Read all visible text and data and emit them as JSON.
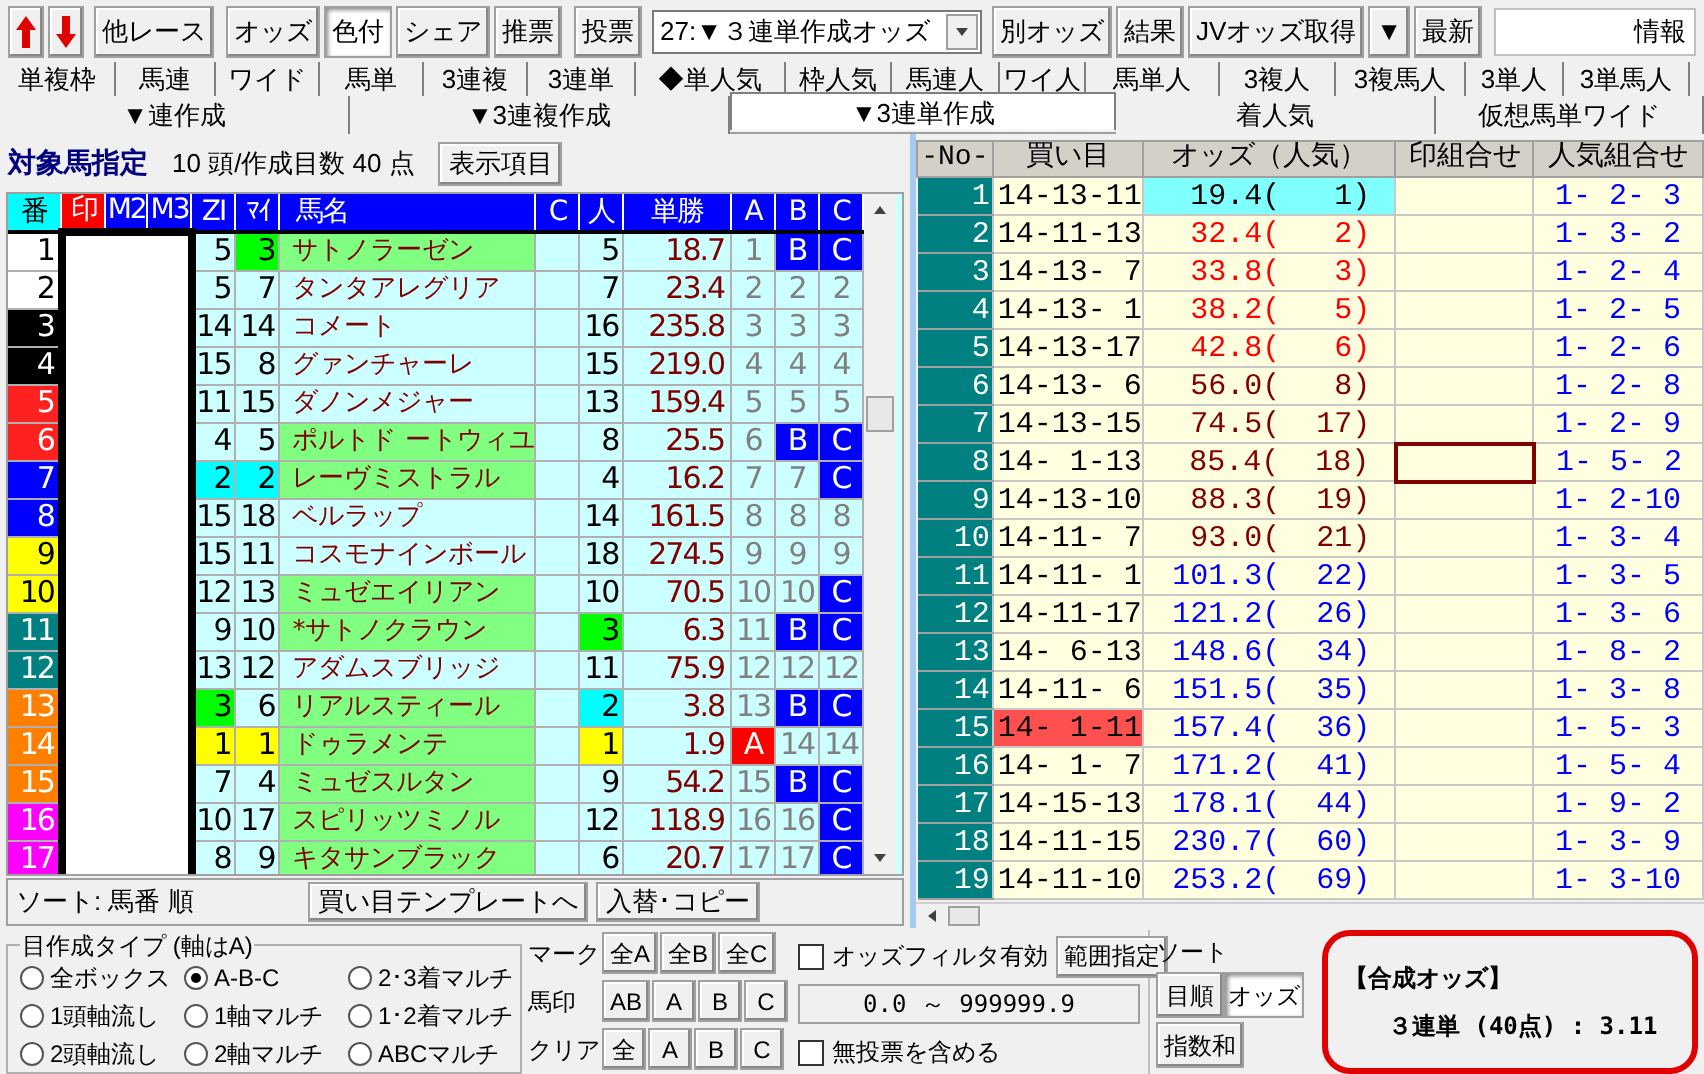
{
  "toolbar": {
    "buttons": [
      {
        "label": "他レース",
        "pressed": false
      },
      {
        "label": "オッズ",
        "pressed": false
      },
      {
        "label": "色付",
        "pressed": true
      },
      {
        "label": "シェア",
        "pressed": false
      },
      {
        "label": "推票",
        "pressed": false
      },
      {
        "label": "投票",
        "pressed": false
      }
    ],
    "dropdown": {
      "value": "27:▼３連単作成オッズ"
    },
    "right_buttons": [
      {
        "label": "別オッズ",
        "pressed": false
      },
      {
        "label": "結果",
        "pressed": false
      },
      {
        "label": "JVオッズ取得",
        "pressed": false
      },
      {
        "label": "▼",
        "pressed": false
      },
      {
        "label": "最新",
        "pressed": false
      }
    ],
    "info": "情報"
  },
  "bet_type_tabs": [
    "単複枠",
    "馬連",
    "ワイド",
    "馬単",
    "3連複",
    "3連単",
    "◆単人気",
    "枠人気",
    "馬連人",
    "ワイ人",
    "馬単人",
    "3複人",
    "3複馬人",
    "3単人",
    "3単馬人"
  ],
  "create_tabs": [
    {
      "label": "▼連作成",
      "selected": false
    },
    {
      "label": "▼3連複作成",
      "selected": false
    },
    {
      "label": "▼3連単作成",
      "selected": true
    },
    {
      "label": "着人気",
      "selected": false
    },
    {
      "label": "仮想馬単ワイド",
      "selected": false
    }
  ],
  "target": {
    "title": "対象馬指定",
    "summary": "10 頭/作成目数 40 点",
    "button": "表示項目"
  },
  "horse_table": {
    "columns": [
      "番",
      "印",
      "M2",
      "M3",
      "ZI",
      "ﾏｲ",
      "馬名",
      "C",
      "人",
      "単勝",
      "A",
      "B",
      "C"
    ],
    "rows": [
      {
        "no": "1",
        "color": "#ffffff",
        "zi": {
          "text": "5"
        },
        "mai": {
          "text": "3",
          "color": "#00ff00"
        },
        "name": "サトノラーゼン",
        "highlighted": true,
        "ninki": {
          "text": "5"
        },
        "win": "18.7",
        "a": {
          "text": "1",
          "marked": false
        },
        "b": {
          "text": "B",
          "marked": true
        },
        "c": {
          "text": "C",
          "marked": true
        }
      },
      {
        "no": "2",
        "color": "#ffffff",
        "zi": {
          "text": "5"
        },
        "mai": {
          "text": "7"
        },
        "name": "タンタアレグリア",
        "highlighted": false,
        "ninki": {
          "text": "7"
        },
        "win": "23.4",
        "a": {
          "text": "2",
          "marked": false
        },
        "b": {
          "text": "2",
          "marked": false
        },
        "c": {
          "text": "2",
          "marked": false
        }
      },
      {
        "no": "3",
        "color": "#000000",
        "zi": {
          "text": "14"
        },
        "mai": {
          "text": "14"
        },
        "name": "コメート",
        "highlighted": false,
        "ninki": {
          "text": "16"
        },
        "win": "235.8",
        "a": {
          "text": "3",
          "marked": false
        },
        "b": {
          "text": "3",
          "marked": false
        },
        "c": {
          "text": "3",
          "marked": false
        }
      },
      {
        "no": "4",
        "color": "#000000",
        "zi": {
          "text": "15"
        },
        "mai": {
          "text": "8"
        },
        "name": "グァンチャーレ",
        "highlighted": false,
        "ninki": {
          "text": "15"
        },
        "win": "219.0",
        "a": {
          "text": "4",
          "marked": false
        },
        "b": {
          "text": "4",
          "marked": false
        },
        "c": {
          "text": "4",
          "marked": false
        }
      },
      {
        "no": "5",
        "color": "#ff2020",
        "zi": {
          "text": "11"
        },
        "mai": {
          "text": "15"
        },
        "name": "ダノンメジャー",
        "highlighted": false,
        "ninki": {
          "text": "13"
        },
        "win": "159.4",
        "a": {
          "text": "5",
          "marked": false
        },
        "b": {
          "text": "5",
          "marked": false
        },
        "c": {
          "text": "5",
          "marked": false
        }
      },
      {
        "no": "6",
        "color": "#ff2020",
        "zi": {
          "text": "4"
        },
        "mai": {
          "text": "5"
        },
        "name": "ポルトド ートウィユ",
        "highlighted": true,
        "ninki": {
          "text": "8"
        },
        "win": "25.5",
        "a": {
          "text": "6",
          "marked": false
        },
        "b": {
          "text": "B",
          "marked": true
        },
        "c": {
          "text": "C",
          "marked": true
        }
      },
      {
        "no": "7",
        "color": "#0000ff",
        "zi": {
          "text": "2",
          "color": "#00ffff"
        },
        "mai": {
          "text": "2",
          "color": "#00ffff"
        },
        "name": "レーヴミストラル",
        "highlighted": true,
        "ninki": {
          "text": "4"
        },
        "win": "16.2",
        "a": {
          "text": "7",
          "marked": false
        },
        "b": {
          "text": "7",
          "marked": false
        },
        "c": {
          "text": "C",
          "marked": true
        }
      },
      {
        "no": "8",
        "color": "#0000ff",
        "zi": {
          "text": "15"
        },
        "mai": {
          "text": "18"
        },
        "name": "ベルラップ",
        "highlighted": false,
        "ninki": {
          "text": "14"
        },
        "win": "161.5",
        "a": {
          "text": "8",
          "marked": false
        },
        "b": {
          "text": "8",
          "marked": false
        },
        "c": {
          "text": "8",
          "marked": false
        }
      },
      {
        "no": "9",
        "color": "#ffff00",
        "zi": {
          "text": "15"
        },
        "mai": {
          "text": "11"
        },
        "name": "コスモナインボール",
        "highlighted": false,
        "ninki": {
          "text": "18"
        },
        "win": "274.5",
        "a": {
          "text": "9",
          "marked": false
        },
        "b": {
          "text": "9",
          "marked": false
        },
        "c": {
          "text": "9",
          "marked": false
        }
      },
      {
        "no": "10",
        "color": "#ffff00",
        "zi": {
          "text": "12"
        },
        "mai": {
          "text": "13"
        },
        "name": "ミュゼエイリアン",
        "highlighted": true,
        "ninki": {
          "text": "10"
        },
        "win": "70.5",
        "a": {
          "text": "10",
          "marked": false
        },
        "b": {
          "text": "10",
          "marked": false
        },
        "c": {
          "text": "C",
          "marked": true
        }
      },
      {
        "no": "11",
        "color": "#008080",
        "zi": {
          "text": "9"
        },
        "mai": {
          "text": "10"
        },
        "name": "*サトノクラウン",
        "highlighted": true,
        "ninki": {
          "text": "3",
          "color": "#00ff00"
        },
        "win": "6.3",
        "a": {
          "text": "11",
          "marked": false
        },
        "b": {
          "text": "B",
          "marked": true
        },
        "c": {
          "text": "C",
          "marked": true
        }
      },
      {
        "no": "12",
        "color": "#008080",
        "zi": {
          "text": "13"
        },
        "mai": {
          "text": "12"
        },
        "name": "アダムスブリッジ",
        "highlighted": false,
        "ninki": {
          "text": "11"
        },
        "win": "75.9",
        "a": {
          "text": "12",
          "marked": false
        },
        "b": {
          "text": "12",
          "marked": false
        },
        "c": {
          "text": "12",
          "marked": false
        }
      },
      {
        "no": "13",
        "color": "#ff8000",
        "zi": {
          "text": "3",
          "color": "#00ff00"
        },
        "mai": {
          "text": "6"
        },
        "name": "リアルスティール",
        "highlighted": true,
        "ninki": {
          "text": "2",
          "color": "#00ffff"
        },
        "win": "3.8",
        "a": {
          "text": "13",
          "marked": false
        },
        "b": {
          "text": "B",
          "marked": true
        },
        "c": {
          "text": "C",
          "marked": true
        }
      },
      {
        "no": "14",
        "color": "#ff8000",
        "zi": {
          "text": "1",
          "color": "#ffff00"
        },
        "mai": {
          "text": "1",
          "color": "#ffff00"
        },
        "name": "ドゥラメンテ",
        "highlighted": true,
        "ninki": {
          "text": "1",
          "color": "#ffff00"
        },
        "win": "1.9",
        "a": {
          "text": "A",
          "marked": true
        },
        "b": {
          "text": "14",
          "marked": false
        },
        "c": {
          "text": "14",
          "marked": false
        }
      },
      {
        "no": "15",
        "color": "#ff8000",
        "zi": {
          "text": "7"
        },
        "mai": {
          "text": "4"
        },
        "name": "ミュゼスルタン",
        "highlighted": true,
        "ninki": {
          "text": "9"
        },
        "win": "54.2",
        "a": {
          "text": "15",
          "marked": false
        },
        "b": {
          "text": "B",
          "marked": true
        },
        "c": {
          "text": "C",
          "marked": true
        }
      },
      {
        "no": "16",
        "color": "#ff00ff",
        "zi": {
          "text": "10"
        },
        "mai": {
          "text": "17"
        },
        "name": "スピリッツミノル",
        "highlighted": true,
        "ninki": {
          "text": "12"
        },
        "win": "118.9",
        "a": {
          "text": "16",
          "marked": false
        },
        "b": {
          "text": "16",
          "marked": false
        },
        "c": {
          "text": "C",
          "marked": true
        }
      },
      {
        "no": "17",
        "color": "#ff00ff",
        "zi": {
          "text": "8"
        },
        "mai": {
          "text": "9"
        },
        "name": "キタサンブラック",
        "highlighted": true,
        "ninki": {
          "text": "6"
        },
        "win": "20.7",
        "a": {
          "text": "17",
          "marked": false
        },
        "b": {
          "text": "17",
          "marked": false
        },
        "c": {
          "text": "C",
          "marked": true
        }
      }
    ]
  },
  "sort_label": "ソート: 馬番 順",
  "left_buttons": [
    "買い目テンプレートへ",
    "入替･コピー"
  ],
  "bet_table": {
    "columns": [
      "-No-",
      "買い目",
      "オッズ（人気）",
      "印組合せ",
      "人気組合せ"
    ],
    "rows": [
      {
        "no": "1",
        "bet": "14-13-11",
        "odds": "19.4(   1)",
        "odds_highlighted": true,
        "bet_highlighted": false,
        "focused": false,
        "popularity": "1- 2- 3"
      },
      {
        "no": "2",
        "bet": "14-11-13",
        "odds": "32.4(   2)",
        "color": "#ff0000",
        "odds_highlighted": false,
        "bet_highlighted": false,
        "focused": false,
        "popularity": "1- 3- 2"
      },
      {
        "no": "3",
        "bet": "14-13- 7",
        "odds": "33.8(   3)",
        "color": "#ff0000",
        "odds_highlighted": false,
        "bet_highlighted": false,
        "focused": false,
        "popularity": "1- 2- 4"
      },
      {
        "no": "4",
        "bet": "14-13- 1",
        "odds": "38.2(   5)",
        "color": "#ff0000",
        "odds_highlighted": false,
        "bet_highlighted": false,
        "focused": false,
        "popularity": "1- 2- 5"
      },
      {
        "no": "5",
        "bet": "14-13-17",
        "odds": "42.8(   6)",
        "color": "#ff0000",
        "odds_highlighted": false,
        "bet_highlighted": false,
        "focused": false,
        "popularity": "1- 2- 6"
      },
      {
        "no": "6",
        "bet": "14-13- 6",
        "odds": "56.0(   8)",
        "color": "#800000",
        "odds_highlighted": false,
        "bet_highlighted": false,
        "focused": false,
        "popularity": "1- 2- 8"
      },
      {
        "no": "7",
        "bet": "14-13-15",
        "odds": "74.5(  17)",
        "color": "#800000",
        "odds_highlighted": false,
        "bet_highlighted": false,
        "focused": false,
        "popularity": "1- 2- 9"
      },
      {
        "no": "8",
        "bet": "14- 1-13",
        "odds": "85.4(  18)",
        "color": "#800000",
        "odds_highlighted": false,
        "bet_highlighted": false,
        "focused": true,
        "popularity": "1- 5- 2"
      },
      {
        "no": "9",
        "bet": "14-13-10",
        "odds": "88.3(  19)",
        "color": "#800000",
        "odds_highlighted": false,
        "bet_highlighted": false,
        "focused": false,
        "popularity": "1- 2-10"
      },
      {
        "no": "10",
        "bet": "14-11- 7",
        "odds": "93.0(  21)",
        "color": "#800000",
        "odds_highlighted": false,
        "bet_highlighted": false,
        "focused": false,
        "popularity": "1- 3- 4"
      },
      {
        "no": "11",
        "bet": "14-11- 1",
        "odds": "101.3(  22)",
        "color": "#0000ff",
        "odds_highlighted": false,
        "bet_highlighted": false,
        "focused": false,
        "popularity": "1- 3- 5"
      },
      {
        "no": "12",
        "bet": "14-11-17",
        "odds": "121.2(  26)",
        "color": "#0000ff",
        "odds_highlighted": false,
        "bet_highlighted": false,
        "focused": false,
        "popularity": "1- 3- 6"
      },
      {
        "no": "13",
        "bet": "14- 6-13",
        "odds": "148.6(  34)",
        "color": "#0000ff",
        "odds_highlighted": false,
        "bet_highlighted": false,
        "focused": false,
        "popularity": "1- 8- 2"
      },
      {
        "no": "14",
        "bet": "14-11- 6",
        "odds": "151.5(  35)",
        "color": "#0000ff",
        "odds_highlighted": false,
        "bet_highlighted": false,
        "focused": false,
        "popularity": "1- 3- 8"
      },
      {
        "no": "15",
        "bet": "14- 1-11",
        "odds": "157.4(  36)",
        "color": "#0000ff",
        "odds_highlighted": false,
        "bet_highlighted": true,
        "focused": false,
        "popularity": "1- 5- 3"
      },
      {
        "no": "16",
        "bet": "14- 1- 7",
        "odds": "171.2(  41)",
        "color": "#0000ff",
        "odds_highlighted": false,
        "bet_highlighted": false,
        "focused": false,
        "popularity": "1- 5- 4"
      },
      {
        "no": "17",
        "bet": "14-15-13",
        "odds": "178.1(  44)",
        "color": "#0000ff",
        "odds_highlighted": false,
        "bet_highlighted": false,
        "focused": false,
        "popularity": "1- 9- 2"
      },
      {
        "no": "18",
        "bet": "14-11-15",
        "odds": "230.7(  60)",
        "color": "#0000ff",
        "odds_highlighted": false,
        "bet_highlighted": false,
        "focused": false,
        "popularity": "1- 3- 9"
      },
      {
        "no": "19",
        "bet": "14-11-10",
        "odds": "253.2(  69)",
        "color": "#0000ff",
        "odds_highlighted": false,
        "bet_highlighted": false,
        "focused": false,
        "popularity": "1- 3-10"
      }
    ]
  },
  "create_type": {
    "title": "目作成タイプ (軸はA)",
    "options": [
      {
        "label": "全ボックス",
        "selected": false
      },
      {
        "label": "A-B-C",
        "selected": true
      },
      {
        "label": "2･3着マルチ",
        "selected": false
      },
      {
        "label": "1頭軸流し",
        "selected": false
      },
      {
        "label": "1軸マルチ",
        "selected": false
      },
      {
        "label": "1･2着マルチ",
        "selected": false
      },
      {
        "label": "2頭軸流し",
        "selected": false
      },
      {
        "label": "2軸マルチ",
        "selected": false
      },
      {
        "label": "ABCマルチ",
        "selected": false
      }
    ]
  },
  "mark_rows": [
    {
      "label": "マーク",
      "buttons": [
        "全A",
        "全B",
        "全C"
      ]
    },
    {
      "label": "馬印",
      "buttons": [
        "AB",
        "A",
        "B",
        "C"
      ]
    },
    {
      "label": "クリア",
      "buttons": [
        "全",
        "A",
        "B",
        "C"
      ]
    }
  ],
  "odds_filter": {
    "label": "オッズフィルタ有効",
    "checked": false,
    "button": "範囲指定",
    "range": "0.0 ～ 999999.9",
    "include_label": "無投票を含める",
    "include_checked": false
  },
  "sort": {
    "title": "ソート",
    "buttons": [
      {
        "label": "目順",
        "pressed": false
      },
      {
        "label": "オッズ",
        "pressed": true
      },
      {
        "label": "指数和",
        "pressed": false
      }
    ]
  },
  "combined_odds": {
    "title": "【合成オッズ】",
    "value": "３連単 (40点) : 3.11"
  }
}
